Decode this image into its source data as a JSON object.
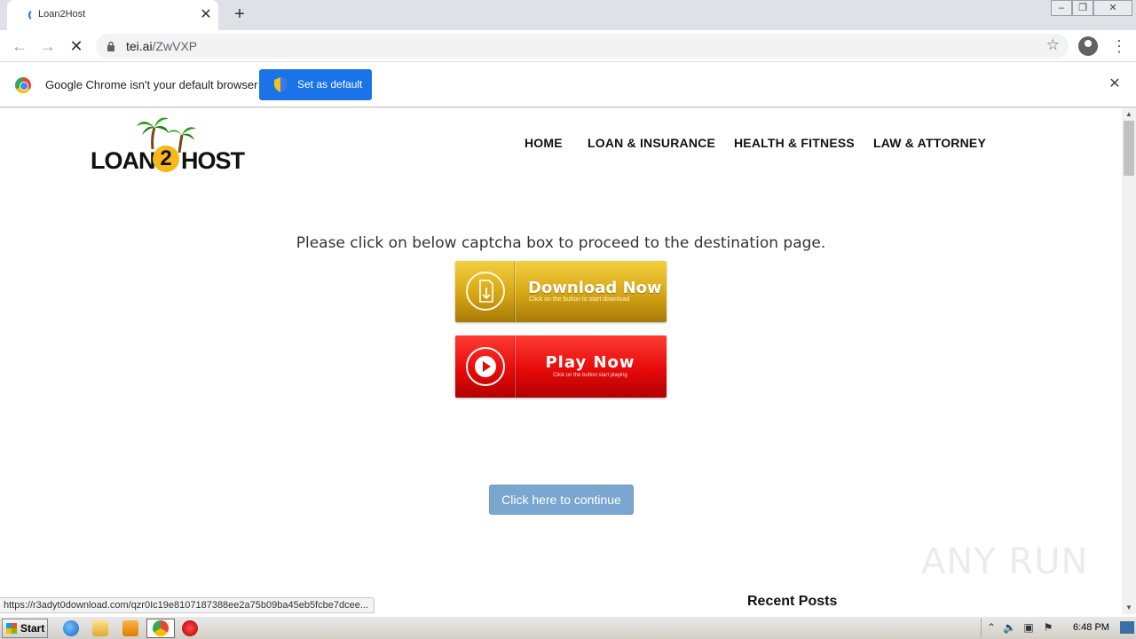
{
  "browser": {
    "tab_title": "Loan2Host",
    "url_domain": "tei.ai",
    "url_path": "/ZwVXP",
    "new_tab_symbol": "+",
    "tab_close_symbol": "✕"
  },
  "infobar": {
    "message": "Google Chrome isn't your default browser",
    "button_label": "Set as default",
    "close_symbol": "✕"
  },
  "site": {
    "logo_left": "LOAN",
    "logo_mid": "2",
    "logo_right": "HOST",
    "nav": [
      "HOME",
      "LOAN & INSURANCE",
      "HEALTH & FITNESS",
      "LAW & ATTORNEY"
    ],
    "instruction": "Please click on below captcha box to proceed to the destination page.",
    "download_button": {
      "title": "Download Now",
      "subtitle": "Click on the button to start download"
    },
    "play_button": {
      "title": "Play Now",
      "subtitle": "Click on the button start playing"
    },
    "continue_button": "Click here to continue",
    "recent_posts": "Recent Posts",
    "watermark": "ANY RUN"
  },
  "status_bar_url": "https://r3adyt0download.com/qzr0Ic19e8107187388ee2a75b09ba45eb5fcbe7dcee...",
  "taskbar": {
    "start_label": "Start",
    "clock": "6:48 PM"
  },
  "colors": {
    "set_default_bg": "#1a73e8",
    "download_gold": "#d6a514",
    "play_red": "#e60a0a",
    "continue_bg": "#7aa6d0"
  }
}
